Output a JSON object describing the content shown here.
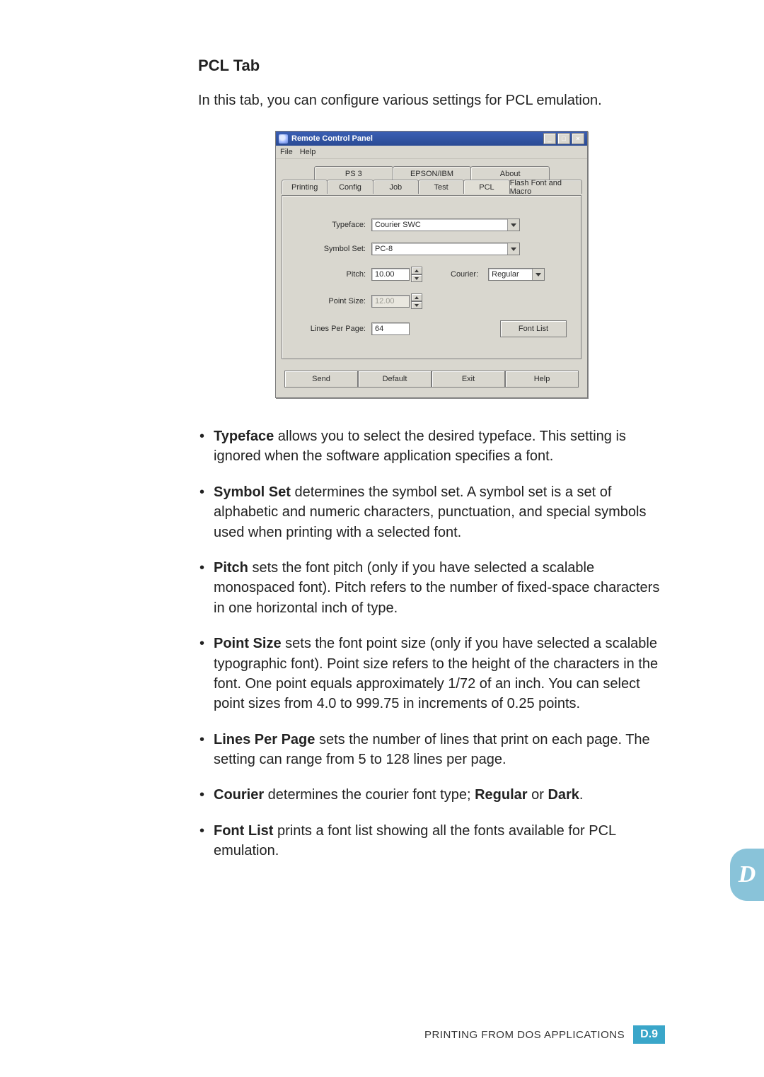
{
  "heading": "PCL Tab",
  "intro": "In this tab, you can configure various settings for PCL emulation.",
  "dialog": {
    "title": "Remote Control Panel",
    "menus": [
      "File",
      "Help"
    ],
    "window_controls": {
      "minimize": "_",
      "maximize": "□",
      "close": "×"
    },
    "tabs_back": [
      "PS 3",
      "EPSON/IBM",
      "About"
    ],
    "tabs_front": [
      "Printing",
      "Config",
      "Job",
      "Test",
      "PCL",
      "Flash Font and Macro"
    ],
    "active_tab": "PCL",
    "fields": {
      "typeface": {
        "label": "Typeface:",
        "value": "Courier SWC"
      },
      "symbol_set": {
        "label": "Symbol Set:",
        "value": "PC-8"
      },
      "pitch": {
        "label": "Pitch:",
        "value": "10.00"
      },
      "courier": {
        "label": "Courier:",
        "value": "Regular"
      },
      "point_size": {
        "label": "Point Size:",
        "value": "12.00",
        "enabled": false
      },
      "lines": {
        "label": "Lines Per Page:",
        "value": "64"
      },
      "font_list_btn": "Font List"
    },
    "buttons": [
      "Send",
      "Default",
      "Exit",
      "Help"
    ]
  },
  "bullets": [
    {
      "term": "Typeface",
      "text": " allows you to select the desired typeface. This setting is ignored when the software application specifies a font."
    },
    {
      "term": "Symbol Set",
      "text": " determines the symbol set. A symbol set is a set of alphabetic and numeric characters, punctuation, and special symbols used when printing with a selected font."
    },
    {
      "term": "Pitch",
      "text": " sets the font pitch (only if you have selected a scalable monospaced font). Pitch refers to the number of fixed-space characters in one horizontal inch of type."
    },
    {
      "term": "Point Size",
      "text": " sets the font point size (only if you have selected a scalable typographic font). Point size refers to the height of the characters in the font. One point equals approximately 1/72 of an inch. You can select point sizes from 4.0 to 999.75 in increments of 0.25 points."
    },
    {
      "term": "Lines Per Page",
      "text": " sets the number of lines that print on each page. The setting can range from 5 to 128 lines per page."
    },
    {
      "term": "Courier",
      "text": " determines the courier font type; ",
      "tail_bold1": "Regular",
      "tail_mid": " or ",
      "tail_bold2": "Dark",
      "tail_end": "."
    },
    {
      "term": "Font List",
      "text": " prints a font list showing all the fonts available for PCL emulation."
    }
  ],
  "side_tab": "D",
  "footer": {
    "text_pre": "P",
    "text_sc1": "RINTING ",
    "text_mid1": "F",
    "text_sc2": "ROM ",
    "text_mid2": "DOS A",
    "text_sc3": "PPLICATIONS",
    "page_prefix": "D.",
    "page_num": "9"
  }
}
